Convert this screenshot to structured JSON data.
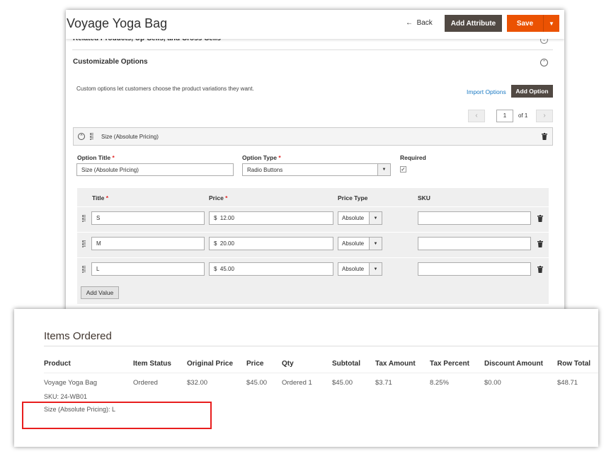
{
  "product_page": {
    "title": "Voyage Yoga Bag",
    "back_label": "Back",
    "add_attribute_label": "Add Attribute",
    "save_label": "Save",
    "related_section": "Related Products, Up-Sells, and Cross-Sells",
    "customizable_section": "Customizable Options",
    "description": "Custom options let customers choose the product variations they want.",
    "import_options_label": "Import Options",
    "add_option_label": "Add Option",
    "pager": {
      "current": "1",
      "of_label": "of 1"
    },
    "option": {
      "header_title": "Size (Absolute Pricing)",
      "option_title_label": "Option Title",
      "option_title_value": "Size (Absolute Pricing)",
      "option_type_label": "Option Type",
      "option_type_value": "Radio Buttons",
      "required_label": "Required",
      "required_checked": true,
      "columns": {
        "title": "Title",
        "price": "Price",
        "price_type": "Price Type",
        "sku": "SKU"
      },
      "values": [
        {
          "title": "S",
          "currency": "$",
          "price": "12.00",
          "price_type": "Absolute",
          "sku": ""
        },
        {
          "title": "M",
          "currency": "$",
          "price": "20.00",
          "price_type": "Absolute",
          "sku": ""
        },
        {
          "title": "L",
          "currency": "$",
          "price": "45.00",
          "price_type": "Absolute",
          "sku": ""
        }
      ],
      "add_value_label": "Add Value"
    },
    "colors": {
      "primary": "#eb5202",
      "dark_button": "#514943",
      "link": "#1979c3"
    }
  },
  "order": {
    "section_title": "Items Ordered",
    "columns": [
      "Product",
      "Item Status",
      "Original Price",
      "Price",
      "Qty",
      "Subtotal",
      "Tax Amount",
      "Tax Percent",
      "Discount Amount",
      "Row Total"
    ],
    "row": [
      "Voyage Yoga Bag",
      "Ordered",
      "$32.00",
      "$45.00",
      "Ordered 1",
      "$45.00",
      "$3.71",
      "8.25%",
      "$0.00",
      "$48.71"
    ],
    "sku": "SKU: 24-WB01",
    "option_line": "Size (Absolute Pricing): L",
    "highlight_color": "#e81e1e"
  }
}
